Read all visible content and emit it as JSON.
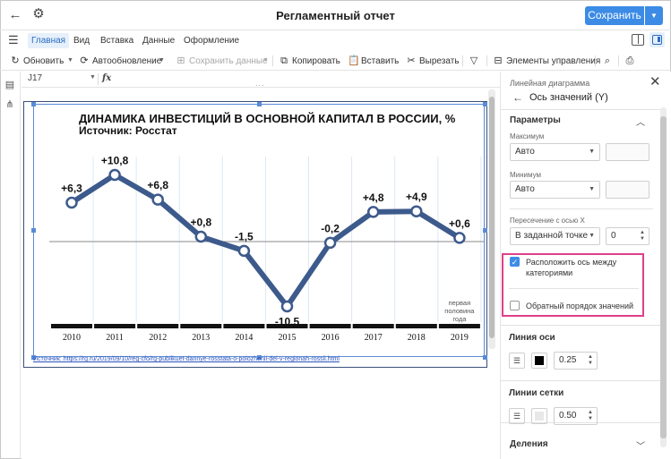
{
  "app": {
    "title": "Регламентный отчет",
    "save_label": "Сохранить"
  },
  "menu": {
    "tabs": [
      "Главная",
      "Вид",
      "Вставка",
      "Данные",
      "Оформление"
    ]
  },
  "toolbar": {
    "refresh": "Обновить",
    "autorefresh": "Автообновление",
    "save_data": "Сохранить данные",
    "copy": "Копировать",
    "paste": "Вставить",
    "cut": "Вырезать",
    "controls": "Элементы управления"
  },
  "formula": {
    "cell_ref": "J17",
    "fx": "fx"
  },
  "chart": {
    "title": "ДИНАМИКА ИНВЕСТИЦИЙ В ОСНОВНОЙ КАПИТАЛ В РОССИИ, %",
    "subtitle": "Источник: Росстат",
    "source_link": "Источник: https://rg.ru/2019/09/10/reg-cfo/rg-publikuet-dannye-rosstata-o-polozhenii-del-v-regionah-rossii.html",
    "last_note": [
      "первая",
      "половина",
      "года"
    ]
  },
  "chart_data": {
    "type": "line",
    "title": "ДИНАМИКА ИНВЕСТИЦИЙ В ОСНОВНОЙ КАПИТАЛ В РОССИИ, %",
    "subtitle": "Источник: Росстат",
    "categories": [
      "2010",
      "2011",
      "2012",
      "2013",
      "2014",
      "2015",
      "2016",
      "2017",
      "2018",
      "2019"
    ],
    "values": [
      6.3,
      10.8,
      6.8,
      0.8,
      -1.5,
      -10.5,
      -0.2,
      4.8,
      4.9,
      0.6
    ],
    "data_labels": [
      "+6,3",
      "+10,8",
      "+6,8",
      "+0,8",
      "-1,5",
      "-10,5",
      "-0,2",
      "+4,8",
      "+4,9",
      "+0,6"
    ],
    "line_color": "#3d5a8c",
    "baseline": 0,
    "ylim": [
      -13,
      12
    ]
  },
  "panel": {
    "header": "Линейная диаграмма",
    "subtitle": "Ось значений (Y)",
    "params_title": "Параметры",
    "max_label": "Максимум",
    "max_value": "Авто",
    "min_label": "Минимум",
    "min_value": "Авто",
    "cross_label": "Пересечение с осью X",
    "cross_value": "В заданной точке",
    "cross_number": "0",
    "cb1_label": "Расположить ось между категориями",
    "cb1_checked": true,
    "cb2_label": "Обратный порядок значений",
    "cb2_checked": false,
    "axis_line_title": "Линия оси",
    "axis_line_width": "0.25",
    "axis_line_color": "#000000",
    "grid_title": "Линии сетки",
    "grid_width": "0.50",
    "grid_color": "#e8e8e8",
    "ticks_title": "Деления"
  },
  "colors": {
    "accent": "#3c8ce6",
    "highlight": "#e0408a"
  }
}
